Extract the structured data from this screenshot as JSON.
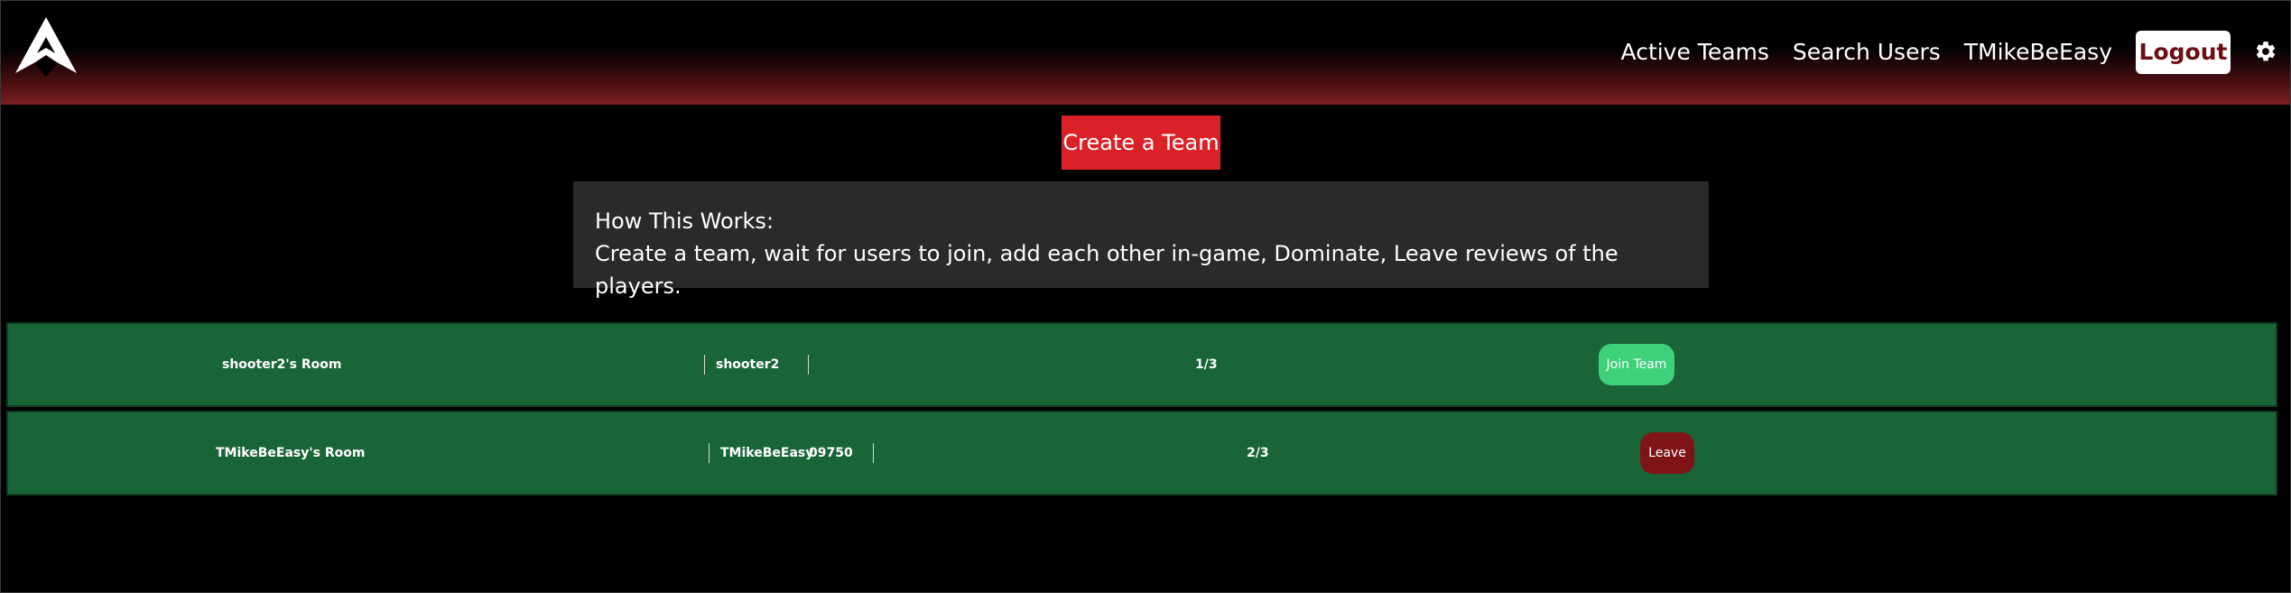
{
  "nav": {
    "logo_icon": "apex-logo-icon",
    "links": [
      "Active Teams",
      "Search Users",
      "TMikeBeEasy"
    ],
    "logout_label": "Logout",
    "settings_icon": "gear-icon"
  },
  "main": {
    "create_team_label": "Create a Team",
    "info": {
      "title": "How This Works:",
      "text": "Create a team, wait for users to join, add each other in-game, Dominate, Leave reviews of the players."
    }
  },
  "teams": [
    {
      "room_name": "shooter2's Room",
      "members": [
        "shooter2"
      ],
      "count": "1/3",
      "action_label": "Join Team"
    },
    {
      "room_name": "TMikeBeEasy's Room",
      "members": [
        "TMikeBeEasy",
        "09750"
      ],
      "count": "2/3",
      "action_label": "Leave"
    }
  ],
  "colors": {
    "nav_gradient_end": "#7e1e21",
    "create_button": "#da2128",
    "info_box": "#2a2a2a",
    "row_bg": "#196537",
    "join_button": "#3ed17a",
    "leave_button": "#7e1418",
    "logout_text": "#6a1014"
  }
}
